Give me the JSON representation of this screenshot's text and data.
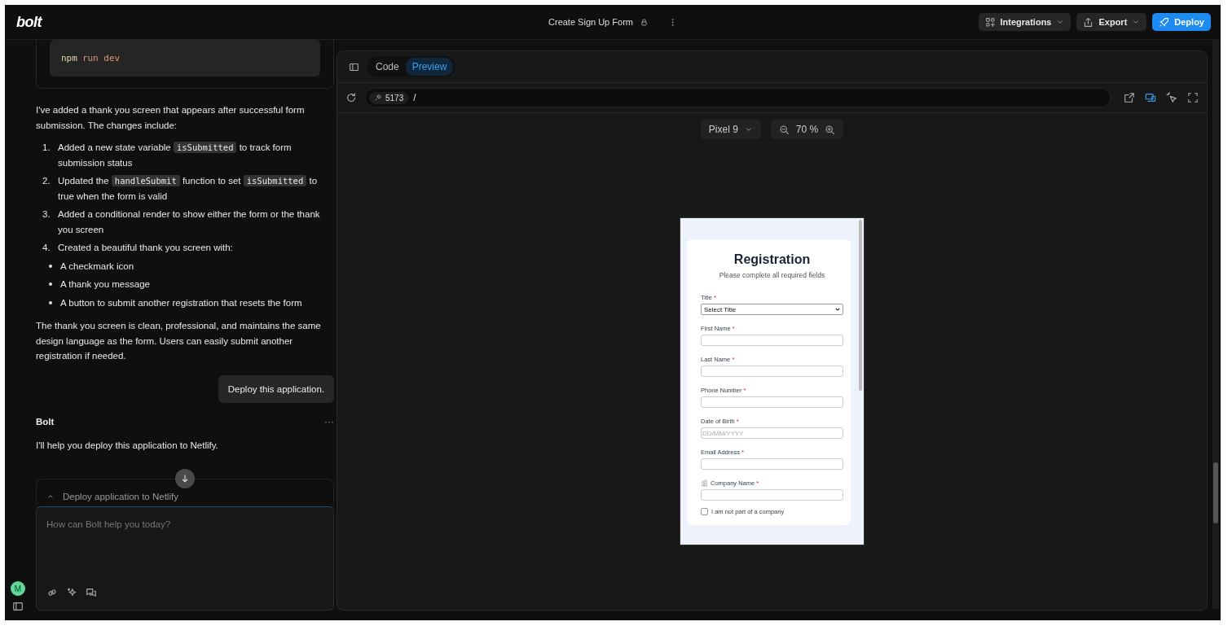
{
  "header": {
    "logo": "bolt",
    "project_title": "Create Sign Up Form",
    "buttons": [
      {
        "label": "Integrations",
        "kind": "integrations"
      },
      {
        "label": "Export",
        "kind": "export"
      },
      {
        "label": "Deploy",
        "kind": "deploy"
      }
    ]
  },
  "chat": {
    "code_block": {
      "tokens": [
        {
          "text": "npm",
          "kind": "command"
        },
        {
          "text": "run dev",
          "kind": "argument"
        }
      ]
    },
    "intro": "I've added a thank you screen that appears after successful form submission. The changes include:",
    "steps": [
      {
        "number": "1.",
        "parts": [
          {
            "text": "Added a new state variable ",
            "kind": "text"
          },
          {
            "text": "isSubmitted",
            "kind": "code"
          },
          {
            "text": " to track form submission status",
            "kind": "text"
          }
        ]
      },
      {
        "number": "2.",
        "parts": [
          {
            "text": "Updated the ",
            "kind": "text"
          },
          {
            "text": "handleSubmit",
            "kind": "code"
          },
          {
            "text": " function to set ",
            "kind": "text"
          },
          {
            "text": "isSubmitted",
            "kind": "code"
          },
          {
            "text": " to true when the form is valid",
            "kind": "text"
          }
        ]
      },
      {
        "number": "3.",
        "parts": [
          {
            "text": "Added a conditional render to show either the form or the thank you screen",
            "kind": "text"
          }
        ]
      },
      {
        "number": "4.",
        "parts": [
          {
            "text": "Created a beautiful thank you screen with:",
            "kind": "text"
          }
        ],
        "bullets": [
          "A checkmark icon",
          "A thank you message",
          "A button to submit another registration that resets the form"
        ]
      }
    ],
    "conclusion": "The thank you screen is clean, professional, and maintains the same design language as the form. Users can easily submit another registration if needed.",
    "user_message": "Deploy this application.",
    "assistant_name": "Bolt",
    "assistant_menu": "···",
    "reply": "I'll help you deploy this application to Netlify.",
    "action_card": {
      "title": "Deploy application to Netlify",
      "expanded": true
    },
    "input": {
      "placeholder": "How can Bolt help you today?"
    },
    "avatar": "M"
  },
  "workbench": {
    "tabs": [
      {
        "label": "Code",
        "selected": false
      },
      {
        "label": "Preview",
        "selected": true
      }
    ],
    "address": {
      "port": "5173",
      "path": "/"
    },
    "device_view": true,
    "device": "Pixel 9",
    "zoom": "70 %",
    "preview": {
      "title": "Registration",
      "subtitle": "Please complete all required fields",
      "fields": [
        {
          "kind": "select",
          "label": "Title",
          "required_mark": "*",
          "value": "Select Title"
        },
        {
          "kind": "text",
          "label": "First Name",
          "required_mark": "*"
        },
        {
          "kind": "text",
          "label": "Last Name",
          "required_mark": "*"
        },
        {
          "kind": "text",
          "label": "Phone Number",
          "required_mark": "*"
        },
        {
          "kind": "text",
          "label": "Date of Birth",
          "required_mark": "*",
          "placeholder": "DD/MM/YYYY"
        },
        {
          "kind": "text",
          "label": "Email Address",
          "required_mark": "*"
        },
        {
          "kind": "company",
          "label": "Company Name",
          "required_mark": "*"
        },
        {
          "kind": "checkbox",
          "label": "I am not part of a company",
          "checked": false
        }
      ]
    }
  }
}
